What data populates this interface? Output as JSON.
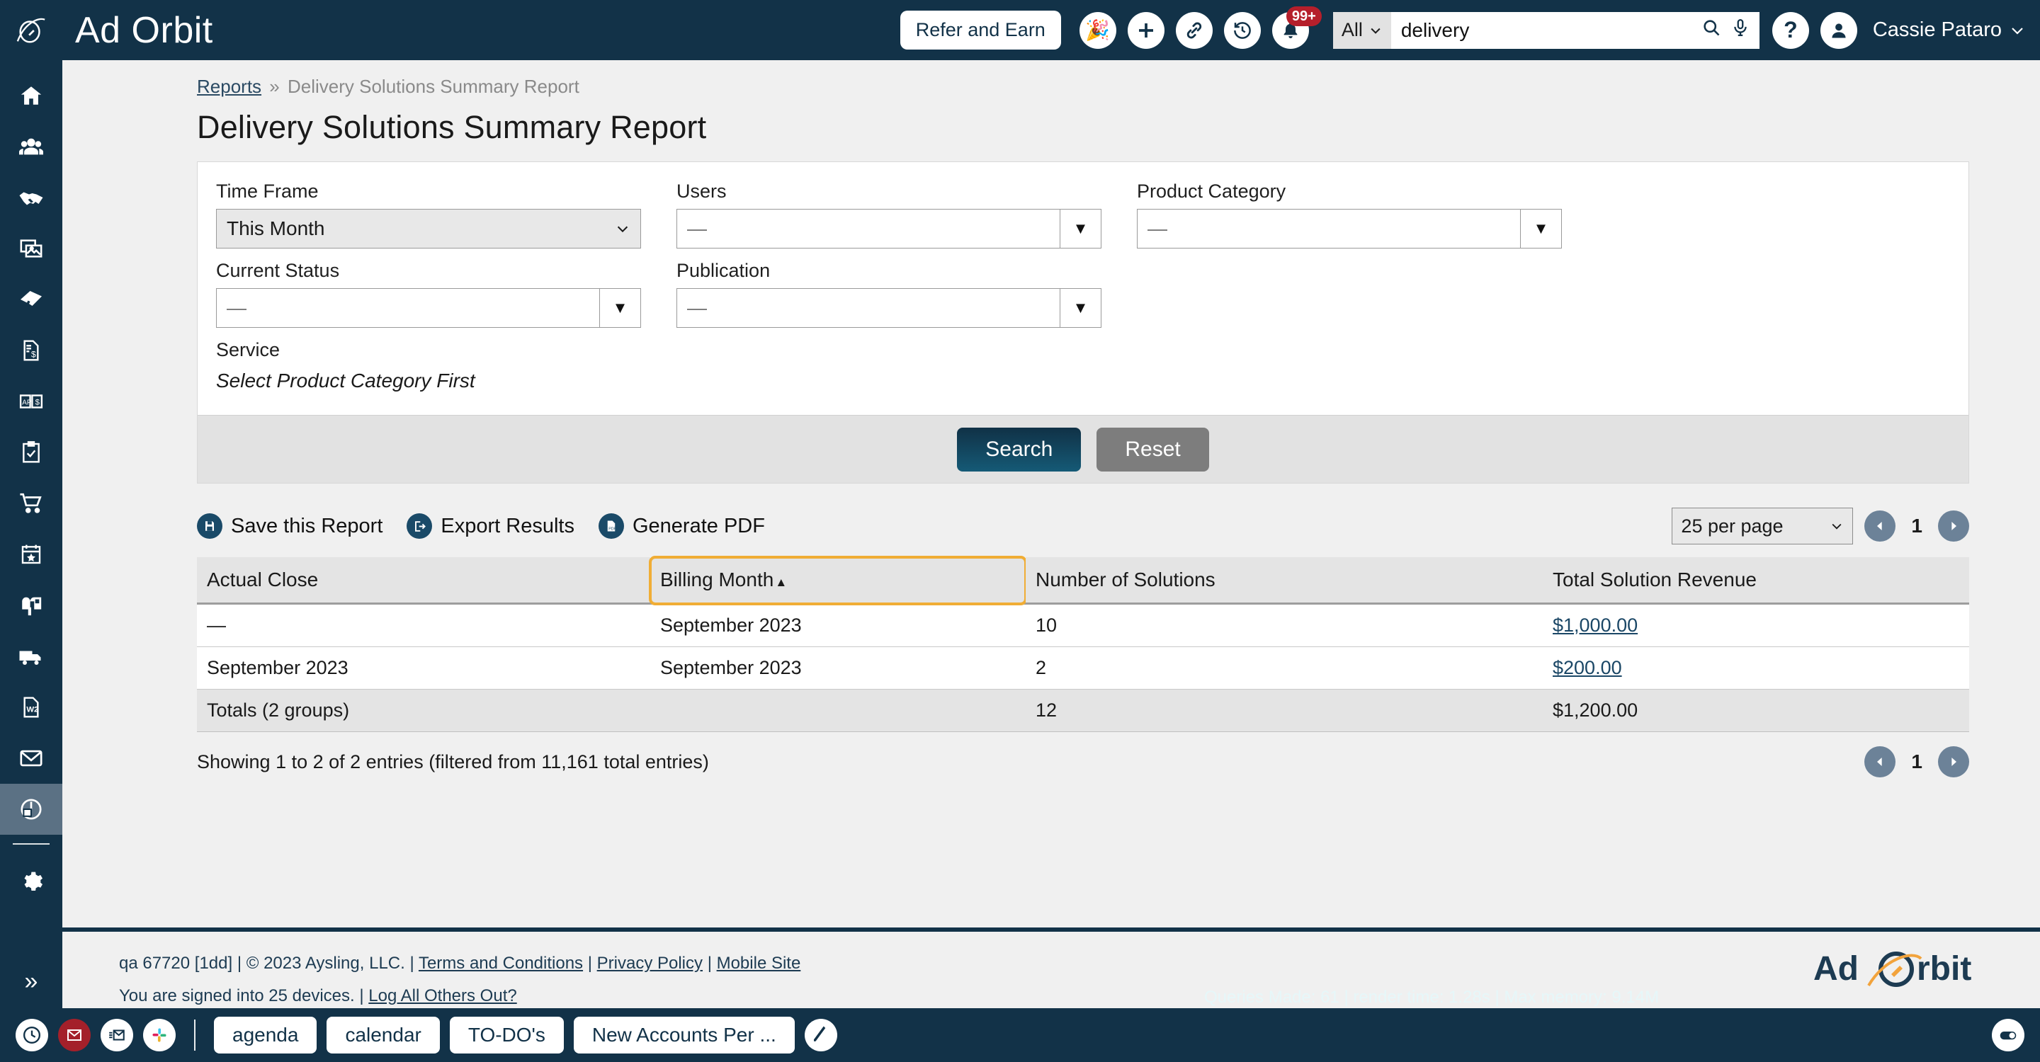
{
  "brand": {
    "name": "Ad Orbit",
    "logo_icon": "orbit-rocket-logo"
  },
  "topbar": {
    "refer_label": "Refer and Earn",
    "icons": [
      {
        "name": "celebration-icon",
        "glyph": "🎉"
      },
      {
        "name": "add-icon",
        "glyph": "+"
      },
      {
        "name": "link-icon",
        "glyph": "🔗"
      },
      {
        "name": "history-icon",
        "glyph": "🕘"
      }
    ],
    "notifications": {
      "name": "bell-icon",
      "badge": "99+"
    },
    "search": {
      "scope": "All",
      "value": "delivery",
      "placeholder": "",
      "search_icon": "search-icon",
      "mic_icon": "microphone-icon"
    },
    "help_icon": "help-icon",
    "user": {
      "name": "Cassie Pataro",
      "avatar_icon": "user-avatar-icon",
      "chevron": "chevron-down-icon"
    }
  },
  "sidebar": {
    "items": [
      {
        "name": "sidebar-item-home",
        "icon": "home-icon",
        "active": false
      },
      {
        "name": "sidebar-item-contacts",
        "icon": "people-icon",
        "active": false
      },
      {
        "name": "sidebar-item-deals",
        "icon": "handshake-icon",
        "active": false
      },
      {
        "name": "sidebar-item-media",
        "icon": "images-icon",
        "active": false
      },
      {
        "name": "sidebar-item-tickets",
        "icon": "ticket-icon",
        "active": false
      },
      {
        "name": "sidebar-item-invoices",
        "icon": "invoice-dollar-icon",
        "active": false
      },
      {
        "name": "sidebar-item-accounts-payable",
        "icon": "ap-book-dollar-icon",
        "active": false
      },
      {
        "name": "sidebar-item-tasks",
        "icon": "clipboard-check-icon",
        "active": false
      },
      {
        "name": "sidebar-item-orders",
        "icon": "shopping-cart-icon",
        "active": false
      },
      {
        "name": "sidebar-item-events",
        "icon": "calendar-star-icon",
        "active": false
      },
      {
        "name": "sidebar-item-subscriptions",
        "icon": "mailbox-icon",
        "active": false
      },
      {
        "name": "sidebar-item-distribution",
        "icon": "truck-icon",
        "active": false
      },
      {
        "name": "sidebar-item-tax-forms",
        "icon": "w2-document-icon",
        "active": false
      },
      {
        "name": "sidebar-item-email",
        "icon": "envelope-icon",
        "active": false
      },
      {
        "name": "sidebar-item-reports",
        "icon": "pie-chart-icon",
        "active": true
      }
    ],
    "settings": {
      "name": "sidebar-item-settings",
      "icon": "gear-icon"
    },
    "expand": {
      "name": "sidebar-expand-toggle",
      "icon": "double-chevron-right-icon",
      "glyph": "»"
    }
  },
  "breadcrumb": {
    "parent": "Reports",
    "separator": "»",
    "current": "Delivery Solutions Summary Report"
  },
  "page_title": "Delivery Solutions Summary Report",
  "filters": {
    "time_frame": {
      "label": "Time Frame",
      "value": "This Month"
    },
    "users": {
      "label": "Users",
      "value": "—"
    },
    "product_category": {
      "label": "Product Category",
      "value": "—"
    },
    "service": {
      "label": "Service",
      "value": "Select Product Category First"
    },
    "current_status": {
      "label": "Current Status",
      "value": "—"
    },
    "publication": {
      "label": "Publication",
      "value": "—"
    },
    "search_label": "Search",
    "reset_label": "Reset"
  },
  "toolbar": {
    "save_label": "Save this Report",
    "export_label": "Export Results",
    "pdf_label": "Generate PDF",
    "save_icon": "save-icon",
    "export_icon": "export-icon",
    "pdf_icon": "pdf-icon"
  },
  "pagination": {
    "per_page": "25 per page",
    "page": "1",
    "prev_icon": "chevron-left-icon",
    "next_icon": "chevron-right-icon"
  },
  "table": {
    "columns": [
      "Actual Close",
      "Billing Month",
      "Number of Solutions",
      "Total Solution Revenue"
    ],
    "sorted_column": "Billing Month",
    "sort_direction": "asc",
    "sort_caret": "▲",
    "highlight_color": "#f0ad35",
    "rows": [
      {
        "actual_close": "—",
        "billing_month": "September 2023",
        "number_of_solutions": "10",
        "total_solution_revenue": "$1,000.00"
      },
      {
        "actual_close": "September 2023",
        "billing_month": "September 2023",
        "number_of_solutions": "2",
        "total_solution_revenue": "$200.00"
      }
    ],
    "totals": {
      "label": "Totals (2 groups)",
      "billing_month": "",
      "number_of_solutions": "12",
      "total_solution_revenue": "$1,200.00"
    }
  },
  "showing": "Showing 1 to 2 of 2 entries (filtered from 11,161 total entries)",
  "footer": {
    "build": "qa 67720 [1dd]",
    "copyright": "© 2023 Aysling, LLC.",
    "terms": "Terms and Conditions",
    "privacy": "Privacy Policy",
    "mobile": "Mobile Site",
    "devices": "You are signed into 25 devices.",
    "logout_all": "Log All Others Out?",
    "stats": "Queries Made: 61 | render time: 1.28s | Max memory: 9.14M",
    "logo_text": "Ad Orbit"
  },
  "taskbar": {
    "icons": [
      {
        "name": "clock-icon",
        "glyph": "🕐",
        "style": "plain"
      },
      {
        "name": "unread-mail-icon",
        "glyph": "✉",
        "style": "red"
      },
      {
        "name": "mail-list-icon",
        "glyph": "✉",
        "style": "plain"
      },
      {
        "name": "slack-icon",
        "glyph": "slack",
        "style": "plain"
      }
    ],
    "tabs": [
      "agenda",
      "calendar",
      "TO-DO's",
      "New Accounts Per ..."
    ],
    "compose_icon": "pencil-icon",
    "toggle_icon": "toggle-switch-icon"
  },
  "colors": {
    "navy": "#123248",
    "accent_orange": "#f0ad35",
    "link": "#1b4766",
    "page_bg": "#f0f0f0"
  }
}
